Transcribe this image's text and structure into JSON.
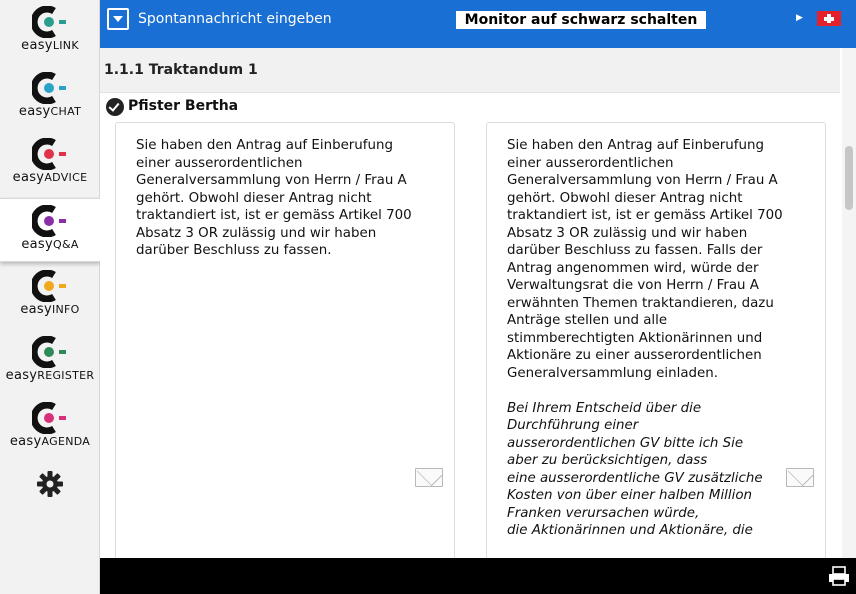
{
  "sidebar": {
    "apps": [
      {
        "prefix": "easy",
        "suffix": "LINK",
        "accent": "#2a9d8f",
        "icon": "easylink-logo-icon"
      },
      {
        "prefix": "easy",
        "suffix": "CHAT",
        "accent": "#29a3c7",
        "icon": "easychat-logo-icon"
      },
      {
        "prefix": "easy",
        "suffix": "ADVICE",
        "accent": "#e0324b",
        "icon": "easyadvice-logo-icon"
      },
      {
        "prefix": "easy",
        "suffix": "Q&A",
        "accent": "#8b2fa8",
        "icon": "easyqa-logo-icon",
        "active": true
      },
      {
        "prefix": "easy",
        "suffix": "INFO",
        "accent": "#f2a81c",
        "icon": "easyinfo-logo-icon"
      },
      {
        "prefix": "easy",
        "suffix": "REGISTER",
        "accent": "#2e8b57",
        "icon": "easyregister-logo-icon"
      },
      {
        "prefix": "easy",
        "suffix": "AGENDA",
        "accent": "#d6307a",
        "icon": "easyagenda-logo-icon"
      }
    ],
    "settings_icon": "gear-icon"
  },
  "topbar": {
    "spontaneous_label": "Spontannachricht eingeben",
    "monitor_button": "Monitor auf schwarz schalten",
    "background": "#1a6fd4"
  },
  "agenda": {
    "title": "1.1.1 Traktandum 1",
    "author": "Pfister Bertha"
  },
  "messages": {
    "left": {
      "text": "Sie haben den Antrag auf Einberufung einer ausserordentlichen Generalversammlung von Herrn / Frau A gehört. Obwohl dieser Antrag nicht traktandiert ist, ist er gemäss Artikel 700 Absatz 3 OR zulässig und wir haben darüber Beschluss zu fassen."
    },
    "right": {
      "text": "Sie haben den Antrag auf Einberufung einer ausserordentlichen Generalversammlung von Herrn / Frau A gehört. Obwohl dieser Antrag nicht traktandiert ist, ist er gemäss Artikel 700 Absatz 3 OR zulässig und wir haben darüber Beschluss zu fassen. Falls der Antrag angenommen wird, würde der Verwaltungsrat die von Herrn / Frau A erwähnten Themen traktandieren, dazu Anträge stellen und alle stimmberechtigten Aktionärinnen und Aktionäre zu einer ausserordentlichen Generalversammlung einladen.",
      "italic_lines": [
        "Bei Ihrem Entscheid über die",
        "Durchführung einer",
        "ausserordentlichen GV bitte ich Sie",
        "aber zu berücksichtigen, dass",
        "eine ausserordentliche GV zusätzliche",
        "Kosten von über einer halben Million",
        "Franken verursachen würde,",
        "die Aktionärinnen und Aktionäre, die"
      ]
    }
  }
}
